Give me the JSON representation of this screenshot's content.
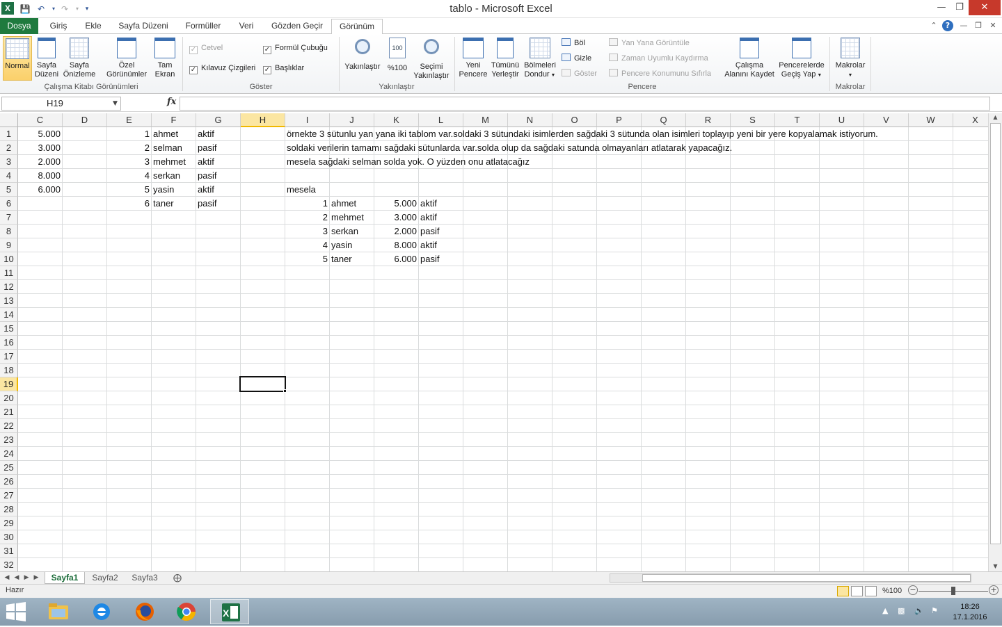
{
  "window": {
    "title": "tablo - Microsoft Excel",
    "app_icon": "X"
  },
  "quick_access": [
    "save-icon",
    "undo-icon",
    "redo-icon",
    "customize-icon"
  ],
  "ribbon_tabs": [
    "Dosya",
    "Giriş",
    "Ekle",
    "Sayfa Düzeni",
    "Formüller",
    "Veri",
    "Gözden Geçir",
    "Görünüm"
  ],
  "active_tab": "Görünüm",
  "ribbon": {
    "workbook_views": {
      "label": "Çalışma Kitabı Görünümleri",
      "normal": "Normal",
      "page_layout": [
        "Sayfa",
        "Düzeni"
      ],
      "page_break": [
        "Sayfa",
        "Önizleme"
      ],
      "custom_views": [
        "Özel",
        "Görünümler"
      ],
      "full_screen": [
        "Tam",
        "Ekran"
      ]
    },
    "show": {
      "label": "Göster",
      "ruler": "Cetvel",
      "gridlines": "Kılavuz Çizgileri",
      "formula_bar": "Formül Çubuğu",
      "headings": "Başlıklar",
      "ruler_checked": true,
      "gridlines_checked": true,
      "formula_bar_checked": true,
      "headings_checked": true
    },
    "zoom": {
      "label": "Yakınlaştır",
      "zoom": "Yakınlaştır",
      "hundred": "%100",
      "hundred_icon": "100",
      "zoom_selection": [
        "Seçimi",
        "Yakınlaştır"
      ]
    },
    "window": {
      "label": "Pencere",
      "new_window": [
        "Yeni",
        "Pencere"
      ],
      "arrange_all": [
        "Tümünü",
        "Yerleştir"
      ],
      "freeze_panes": [
        "Bölmeleri",
        "Dondur"
      ],
      "split": "Böl",
      "hide": "Gizle",
      "unhide": "Göster",
      "side_by_side": "Yan Yana Görüntüle",
      "sync_scroll": "Zaman Uyumlu Kaydırma",
      "reset_position": "Pencere Konumunu Sıfırla",
      "save_workspace": [
        "Çalışma",
        "Alanını Kaydet"
      ],
      "switch_windows": [
        "Pencerelerde",
        "Geçiş Yap"
      ]
    },
    "macros": {
      "label": "Makrolar",
      "button": "Makrolar"
    }
  },
  "formula_bar": {
    "name_box": "H19",
    "fx": "fx",
    "value": ""
  },
  "columns": [
    "C",
    "D",
    "E",
    "F",
    "G",
    "H",
    "I",
    "J",
    "K",
    "L",
    "M",
    "N",
    "O",
    "P",
    "Q",
    "R",
    "S",
    "T",
    "U",
    "V",
    "W",
    "X"
  ],
  "rows": [
    "1",
    "2",
    "3",
    "4",
    "5",
    "6",
    "7",
    "8",
    "9",
    "10",
    "11",
    "12",
    "13",
    "14",
    "15",
    "16",
    "17",
    "18",
    "19",
    "20",
    "21",
    "22",
    "23",
    "24",
    "25",
    "26",
    "27",
    "28",
    "29",
    "30",
    "31",
    "32"
  ],
  "selected_cell": "H19",
  "cells": [
    {
      "col": "C",
      "row": 1,
      "value": "5.000",
      "num": true
    },
    {
      "col": "C",
      "row": 2,
      "value": "3.000",
      "num": true
    },
    {
      "col": "C",
      "row": 3,
      "value": "2.000",
      "num": true
    },
    {
      "col": "C",
      "row": 4,
      "value": "8.000",
      "num": true
    },
    {
      "col": "C",
      "row": 5,
      "value": "6.000",
      "num": true
    },
    {
      "col": "E",
      "row": 1,
      "value": "1",
      "num": true
    },
    {
      "col": "E",
      "row": 2,
      "value": "2",
      "num": true
    },
    {
      "col": "E",
      "row": 3,
      "value": "3",
      "num": true
    },
    {
      "col": "E",
      "row": 4,
      "value": "4",
      "num": true
    },
    {
      "col": "E",
      "row": 5,
      "value": "5",
      "num": true
    },
    {
      "col": "E",
      "row": 6,
      "value": "6",
      "num": true
    },
    {
      "col": "F",
      "row": 1,
      "value": "ahmet"
    },
    {
      "col": "F",
      "row": 2,
      "value": "selman"
    },
    {
      "col": "F",
      "row": 3,
      "value": "mehmet"
    },
    {
      "col": "F",
      "row": 4,
      "value": "serkan"
    },
    {
      "col": "F",
      "row": 5,
      "value": "yasin"
    },
    {
      "col": "F",
      "row": 6,
      "value": "taner"
    },
    {
      "col": "G",
      "row": 1,
      "value": "aktif"
    },
    {
      "col": "G",
      "row": 2,
      "value": "pasif"
    },
    {
      "col": "G",
      "row": 3,
      "value": "aktif"
    },
    {
      "col": "G",
      "row": 4,
      "value": "pasif"
    },
    {
      "col": "G",
      "row": 5,
      "value": "aktif"
    },
    {
      "col": "G",
      "row": 6,
      "value": "pasif"
    },
    {
      "col": "I",
      "row": 1,
      "value": "örnekte 3 sütunlu yan yana iki tablom var.soldaki 3 sütundaki isimlerden sağdaki 3 sütunda olan isimleri toplayıp yeni bir yere kopyalamak istiyorum."
    },
    {
      "col": "I",
      "row": 2,
      "value": "soldaki verilerin tamamı sağdaki sütunlarda var.solda olup da sağdaki satunda olmayanları atlatarak yapacağız."
    },
    {
      "col": "I",
      "row": 3,
      "value": "mesela sağdaki selman solda yok. O yüzden onu atlatacağız"
    },
    {
      "col": "I",
      "row": 5,
      "value": "mesela"
    },
    {
      "col": "I",
      "row": 6,
      "value": "1",
      "num": true
    },
    {
      "col": "I",
      "row": 7,
      "value": "2",
      "num": true
    },
    {
      "col": "I",
      "row": 8,
      "value": "3",
      "num": true
    },
    {
      "col": "I",
      "row": 9,
      "value": "4",
      "num": true
    },
    {
      "col": "I",
      "row": 10,
      "value": "5",
      "num": true
    },
    {
      "col": "J",
      "row": 6,
      "value": "ahmet"
    },
    {
      "col": "J",
      "row": 7,
      "value": "mehmet"
    },
    {
      "col": "J",
      "row": 8,
      "value": "serkan"
    },
    {
      "col": "J",
      "row": 9,
      "value": "yasin"
    },
    {
      "col": "J",
      "row": 10,
      "value": "taner"
    },
    {
      "col": "K",
      "row": 6,
      "value": "5.000",
      "num": true
    },
    {
      "col": "K",
      "row": 7,
      "value": "3.000",
      "num": true
    },
    {
      "col": "K",
      "row": 8,
      "value": "2.000",
      "num": true
    },
    {
      "col": "K",
      "row": 9,
      "value": "8.000",
      "num": true
    },
    {
      "col": "K",
      "row": 10,
      "value": "6.000",
      "num": true
    },
    {
      "col": "L",
      "row": 6,
      "value": "aktif"
    },
    {
      "col": "L",
      "row": 7,
      "value": "aktif"
    },
    {
      "col": "L",
      "row": 8,
      "value": "pasif"
    },
    {
      "col": "L",
      "row": 9,
      "value": "aktif"
    },
    {
      "col": "L",
      "row": 10,
      "value": "pasif"
    }
  ],
  "sheets": [
    "Sayfa1",
    "Sayfa2",
    "Sayfa3"
  ],
  "active_sheet": "Sayfa1",
  "status": {
    "text": "Hazır",
    "zoom": "%100"
  },
  "taskbar": {
    "apps": [
      "file-explorer-icon",
      "internet-explorer-icon",
      "firefox-icon",
      "chrome-icon",
      "excel-icon"
    ],
    "time": "18:26",
    "date": "17.1.2016"
  },
  "colors": {
    "excel_green": "#1f7a3e",
    "selection_highlight": "#fbe6a2",
    "close_red": "#c7392b"
  }
}
